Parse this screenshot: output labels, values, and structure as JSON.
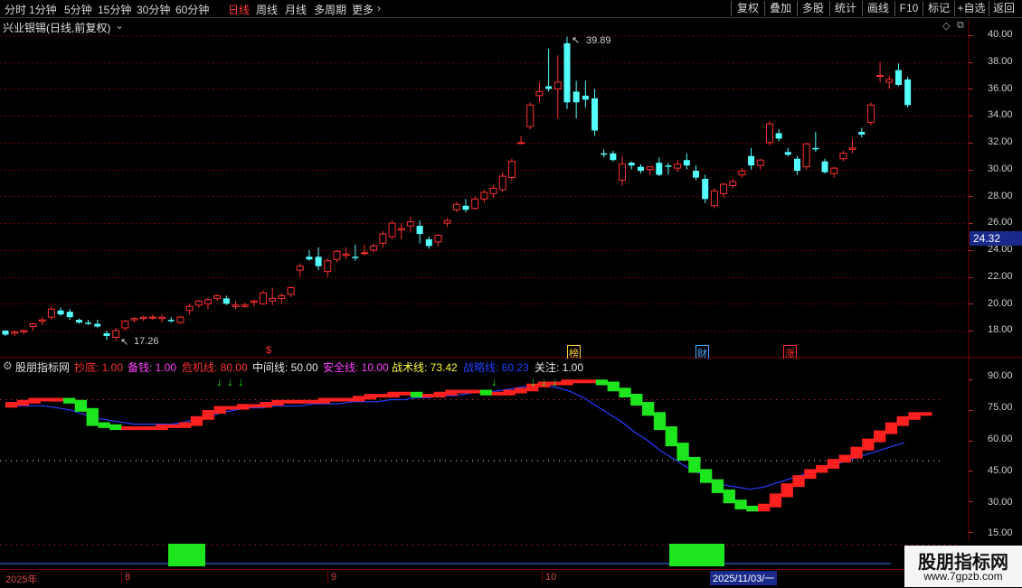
{
  "toolbar": {
    "periods": [
      "分时",
      "1分钟",
      "5分钟",
      "15分钟",
      "30分钟",
      "60分钟",
      "日线",
      "周线",
      "月线",
      "多周期",
      "更多"
    ],
    "active_period": "日线",
    "right_buttons": [
      "复权",
      "叠加",
      "多股",
      "统计",
      "画线",
      "F10",
      "+自选",
      "标记",
      "返回"
    ]
  },
  "main": {
    "title": "兴业银锡(日线,前复权)",
    "price_axis": [
      "40.00",
      "38.00",
      "36.00",
      "34.00",
      "32.00",
      "30.00",
      "28.00",
      "26.00",
      "24.00",
      "22.00",
      "20.00",
      "18.00"
    ],
    "current_price": "24.32",
    "high_label": "39.89",
    "low_label": "17.26",
    "events": [
      {
        "label": "$",
        "color": "#ff3030"
      },
      {
        "label": "榜",
        "color": "#ffcc33"
      },
      {
        "label": "财",
        "color": "#4aa8ff"
      },
      {
        "label": "涨",
        "color": "#ff3030"
      }
    ],
    "colors": {
      "up": "#ff3030",
      "down": "#54ffff"
    }
  },
  "indicator": {
    "name": "股朋指标网",
    "params": [
      {
        "label": "抄底: ",
        "value": "1.00",
        "color": "#ff3030"
      },
      {
        "label": "备钱: ",
        "value": "1.00",
        "color": "#ff40ff"
      },
      {
        "label": "危机线: ",
        "value": "80.00",
        "color": "#ff3030"
      },
      {
        "label": "中间线: ",
        "value": "50.00",
        "color": "#e8e8e8"
      },
      {
        "label": "安全线: ",
        "value": "10.00",
        "color": "#ff40ff"
      },
      {
        "label": "战术线: ",
        "value": "73.42",
        "color": "#ffff33"
      },
      {
        "label": "战略线: ",
        "value": "60.23",
        "color": "#2040ff"
      },
      {
        "label": "关注: ",
        "value": "1.00",
        "color": "#e8e8e8"
      }
    ],
    "axis": [
      "90.00",
      "75.00",
      "60.00",
      "45.00",
      "30.00",
      "15.00"
    ]
  },
  "dates": {
    "labels": [
      "2025年",
      "8",
      "9",
      "10"
    ],
    "cursor": "2025/11/03/一"
  },
  "watermark": {
    "title": "股朋指标网",
    "url": "www.7gpzb.com"
  },
  "chart_data": {
    "type": "candlestick",
    "series": [
      {
        "name": "OHLC",
        "values": [
          [
            18.0,
            18.0,
            17.6,
            17.7
          ],
          [
            17.8,
            18.0,
            17.6,
            17.9
          ],
          [
            17.9,
            18.1,
            17.7,
            18.0
          ],
          [
            18.3,
            18.6,
            18.0,
            18.5
          ],
          [
            18.7,
            19.0,
            18.4,
            18.8
          ],
          [
            19.0,
            19.8,
            18.8,
            19.6
          ],
          [
            19.5,
            19.7,
            19.1,
            19.2
          ],
          [
            19.4,
            19.6,
            18.8,
            19.0
          ],
          [
            18.8,
            18.9,
            18.5,
            18.6
          ],
          [
            18.6,
            18.8,
            18.4,
            18.5
          ],
          [
            18.5,
            18.8,
            18.2,
            18.3
          ],
          [
            17.8,
            18.0,
            17.3,
            17.6
          ],
          [
            17.5,
            18.2,
            17.26,
            18.0
          ],
          [
            18.2,
            18.8,
            18.0,
            18.7
          ],
          [
            18.8,
            19.0,
            18.6,
            18.9
          ],
          [
            18.9,
            19.1,
            18.7,
            19.0
          ],
          [
            19.0,
            19.2,
            18.8,
            19.0
          ],
          [
            18.9,
            19.2,
            18.6,
            19.0
          ],
          [
            18.8,
            19.0,
            18.6,
            18.7
          ],
          [
            18.6,
            19.1,
            18.5,
            19.0
          ],
          [
            19.5,
            20.0,
            19.2,
            19.8
          ],
          [
            19.9,
            20.3,
            19.7,
            20.2
          ],
          [
            20.0,
            20.4,
            19.6,
            20.3
          ],
          [
            20.4,
            20.7,
            20.2,
            20.6
          ],
          [
            20.4,
            20.6,
            19.9,
            20.0
          ],
          [
            19.8,
            20.2,
            19.6,
            19.9
          ],
          [
            19.8,
            20.1,
            19.7,
            19.9
          ],
          [
            20.1,
            20.3,
            19.8,
            20.2
          ],
          [
            20.0,
            21.0,
            19.9,
            20.8
          ],
          [
            20.2,
            21.2,
            19.9,
            20.4
          ],
          [
            20.4,
            20.8,
            20.0,
            20.6
          ],
          [
            20.7,
            21.3,
            20.5,
            21.2
          ],
          [
            22.5,
            23.0,
            22.0,
            22.8
          ],
          [
            23.5,
            24.0,
            23.2,
            23.3
          ],
          [
            23.5,
            24.2,
            22.5,
            22.8
          ],
          [
            22.4,
            23.4,
            22.0,
            23.2
          ],
          [
            23.3,
            24.0,
            23.1,
            23.9
          ],
          [
            23.6,
            24.2,
            23.3,
            23.7
          ],
          [
            23.5,
            24.4,
            23.2,
            23.4
          ],
          [
            23.8,
            24.4,
            23.6,
            23.8
          ],
          [
            24.0,
            24.5,
            23.8,
            24.3
          ],
          [
            24.5,
            25.4,
            24.2,
            25.2
          ],
          [
            25.0,
            26.2,
            24.8,
            26.0
          ],
          [
            25.5,
            26.0,
            24.8,
            25.6
          ],
          [
            25.8,
            26.5,
            25.3,
            26.1
          ],
          [
            25.8,
            26.2,
            24.5,
            25.2
          ],
          [
            24.8,
            25.0,
            24.1,
            24.3
          ],
          [
            24.6,
            25.2,
            24.3,
            25.1
          ],
          [
            26.0,
            26.4,
            25.7,
            26.2
          ],
          [
            27.0,
            27.6,
            26.8,
            27.4
          ],
          [
            27.3,
            27.8,
            26.8,
            27.0
          ],
          [
            27.1,
            28.0,
            27.0,
            27.8
          ],
          [
            27.8,
            28.5,
            27.5,
            28.3
          ],
          [
            28.2,
            28.8,
            27.9,
            28.6
          ],
          [
            28.5,
            29.8,
            28.3,
            29.5
          ],
          [
            29.4,
            30.8,
            29.2,
            30.6
          ],
          [
            32.0,
            32.5,
            31.9,
            32.0
          ],
          [
            33.2,
            35.0,
            33.0,
            34.8
          ],
          [
            35.5,
            36.5,
            35.0,
            35.8
          ],
          [
            36.2,
            39.0,
            35.8,
            36.0
          ],
          [
            36.0,
            38.5,
            33.8,
            36.5
          ],
          [
            39.4,
            39.89,
            34.5,
            35.0
          ],
          [
            35.8,
            36.6,
            33.8,
            35.0
          ],
          [
            35.5,
            36.6,
            34.6,
            35.2
          ],
          [
            35.3,
            36.0,
            32.5,
            32.9
          ],
          [
            31.2,
            31.5,
            30.9,
            31.1
          ],
          [
            31.2,
            31.4,
            30.6,
            30.7
          ],
          [
            29.2,
            31.0,
            28.8,
            30.4
          ],
          [
            30.5,
            30.6,
            30.0,
            30.3
          ],
          [
            30.2,
            30.4,
            29.7,
            29.9
          ],
          [
            30.0,
            30.2,
            29.6,
            30.2
          ],
          [
            30.5,
            30.9,
            29.5,
            29.6
          ],
          [
            30.3,
            30.5,
            29.6,
            30.2
          ],
          [
            30.1,
            30.7,
            29.8,
            30.4
          ],
          [
            30.7,
            31.2,
            30.0,
            30.3
          ],
          [
            29.9,
            30.3,
            29.2,
            29.4
          ],
          [
            29.3,
            29.6,
            27.5,
            27.8
          ],
          [
            27.3,
            28.6,
            27.1,
            28.4
          ],
          [
            28.2,
            29.0,
            27.9,
            28.9
          ],
          [
            28.8,
            29.3,
            28.6,
            29.1
          ],
          [
            29.6,
            30.1,
            29.4,
            29.9
          ],
          [
            31.0,
            31.6,
            30.0,
            30.3
          ],
          [
            30.3,
            30.8,
            30.0,
            30.7
          ],
          [
            32.0,
            33.6,
            31.8,
            33.4
          ],
          [
            32.7,
            33.0,
            32.1,
            32.3
          ],
          [
            31.3,
            31.6,
            31.0,
            31.1
          ],
          [
            30.8,
            31.0,
            29.6,
            29.9
          ],
          [
            30.2,
            32.0,
            30.0,
            31.9
          ],
          [
            31.6,
            32.8,
            31.3,
            31.5
          ],
          [
            30.6,
            30.8,
            29.7,
            29.8
          ],
          [
            29.7,
            30.2,
            29.4,
            30.1
          ],
          [
            30.8,
            31.4,
            30.6,
            31.2
          ],
          [
            31.5,
            32.3,
            31.2,
            31.6
          ],
          [
            32.8,
            33.1,
            32.4,
            32.6
          ],
          [
            33.5,
            35.0,
            33.3,
            34.8
          ],
          [
            37.0,
            38.0,
            36.5,
            37.0
          ],
          [
            36.5,
            37.0,
            36.0,
            36.7
          ],
          [
            37.4,
            37.9,
            36.2,
            36.3
          ],
          [
            36.7,
            36.9,
            34.6,
            34.8
          ]
        ]
      },
      {
        "name": "战术线",
        "values": [
          77,
          78,
          79,
          80,
          80,
          80,
          79,
          75,
          68,
          67,
          66,
          66,
          66,
          66,
          67,
          67,
          68,
          71,
          74,
          76,
          76,
          77,
          77,
          78,
          79,
          79,
          79,
          79,
          80,
          80,
          80,
          81,
          82,
          82,
          83,
          83,
          82,
          82,
          83,
          84,
          84,
          84,
          83,
          83,
          84,
          85,
          87,
          88,
          88,
          89,
          89,
          89,
          88,
          85,
          82,
          78,
          73,
          66,
          58,
          51,
          45,
          40,
          35,
          30,
          27,
          26,
          28,
          33,
          38,
          42,
          45,
          47,
          50,
          52,
          56,
          60,
          64,
          68,
          71,
          73,
          73
        ]
      },
      {
        "name": "战略线",
        "values": [
          77,
          77,
          77,
          77,
          76,
          75,
          73,
          71,
          70,
          69,
          68,
          68,
          68,
          68,
          69,
          71,
          72,
          74,
          75,
          76,
          76,
          77,
          77,
          77,
          78,
          78,
          78,
          79,
          79,
          79,
          80,
          80,
          81,
          81,
          82,
          82,
          83,
          84,
          84,
          85,
          86,
          87,
          87,
          86,
          84,
          81,
          77,
          73,
          69,
          64,
          60,
          55,
          51,
          47,
          44,
          41,
          38,
          37,
          36,
          37,
          39,
          41,
          43,
          45,
          47,
          49,
          51,
          53,
          55,
          57,
          59
        ]
      }
    ],
    "ylim": [
      17,
      40.5
    ]
  }
}
